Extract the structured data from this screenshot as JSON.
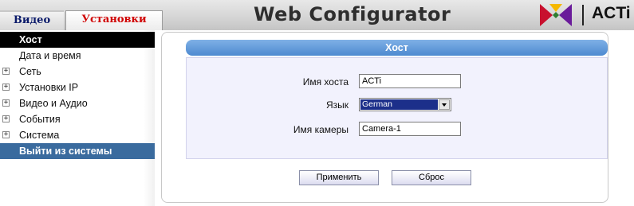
{
  "header": {
    "tabs": [
      {
        "label": "Видео"
      },
      {
        "label": "Установки"
      }
    ],
    "title": "Web Configurator",
    "logo_text": "ACTi"
  },
  "sidebar": {
    "items": [
      {
        "label": "Хост",
        "state": "active"
      },
      {
        "label": "Дата и время"
      },
      {
        "label": "Сеть",
        "expandable": true
      },
      {
        "label": "Установки IP",
        "expandable": true
      },
      {
        "label": "Видео и Аудио",
        "expandable": true
      },
      {
        "label": "События",
        "expandable": true
      },
      {
        "label": "Система",
        "expandable": true
      },
      {
        "label": "Выйти из системы",
        "state": "highlighted"
      }
    ]
  },
  "main": {
    "section_title": "Хост",
    "fields": {
      "host_name": {
        "label": "Имя хоста",
        "value": "ACTi"
      },
      "language": {
        "label": "Язык",
        "value": "German"
      },
      "camera_name": {
        "label": "Имя камеры",
        "value": "Camera-1"
      }
    },
    "buttons": {
      "apply": "Применить",
      "reset": "Сброс"
    }
  },
  "colors": {
    "active_tab_text": "#d00000",
    "inactive_tab_text": "#0a1a6a",
    "section_title_bg": "#4d8ad0",
    "logout_bg": "#3a6b9e",
    "form_bg": "#f2f2fd"
  },
  "icons": {
    "expand": "plus-square-icon",
    "logo": "acti-logo-icon"
  }
}
